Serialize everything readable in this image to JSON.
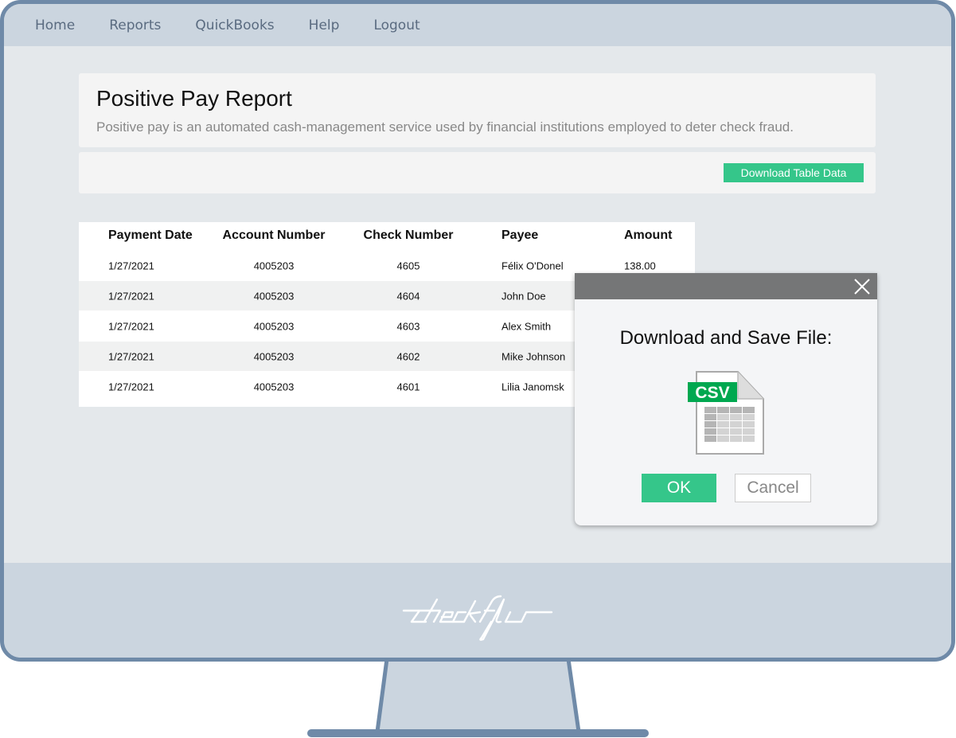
{
  "nav": {
    "items": [
      "Home",
      "Reports",
      "QuickBooks",
      "Help",
      "Logout"
    ]
  },
  "header": {
    "title": "Positive Pay Report",
    "subtitle": "Positive pay is an automated cash-management service used by financial institutions employed to deter check fraud."
  },
  "toolbar": {
    "download_label": "Download Table Data"
  },
  "table": {
    "columns": [
      "Payment Date",
      "Account Number",
      "Check Number",
      "Payee",
      "Amount"
    ],
    "rows": [
      [
        "1/27/2021",
        "4005203",
        "4605",
        "Félix O'Donel",
        "138.00"
      ],
      [
        "1/27/2021",
        "4005203",
        "4604",
        "John Doe",
        ""
      ],
      [
        "1/27/2021",
        "4005203",
        "4603",
        "Alex Smith",
        ""
      ],
      [
        "1/27/2021",
        "4005203",
        "4602",
        "Mike Johnson",
        ""
      ],
      [
        "1/27/2021",
        "4005203",
        "4601",
        "Lilia Janomsk",
        ""
      ]
    ]
  },
  "modal": {
    "title": "Download and Save File:",
    "file_badge": "CSV",
    "ok_label": "OK",
    "cancel_label": "Cancel",
    "close_icon": "close-icon"
  },
  "brand": {
    "logo_text": "checkflo"
  },
  "colors": {
    "accent": "#35c68a",
    "frame": "#6f8aa8",
    "csv_badge": "#00a850"
  }
}
